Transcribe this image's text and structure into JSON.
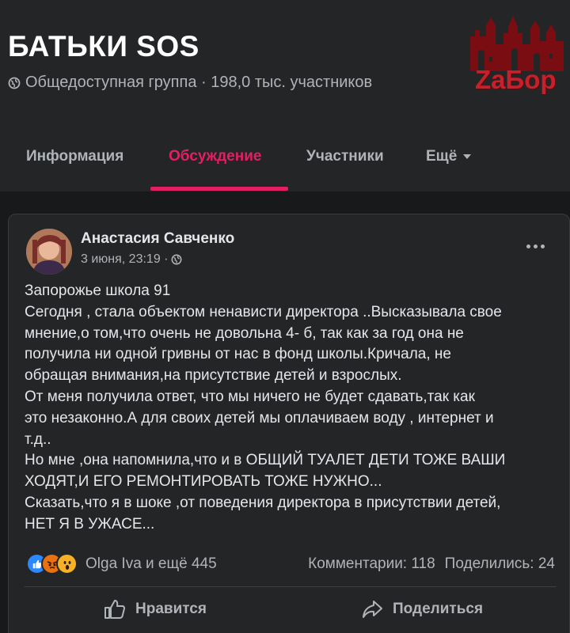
{
  "group": {
    "name": "БАТЬКИ SOS",
    "meta": "Общедоступная группа · 198,0 тыс. участников",
    "globe_icon": "globe-icon"
  },
  "logo": {
    "text": "ZaБор",
    "color": "#c6202a"
  },
  "tabs": [
    {
      "label": "Информация",
      "active": false
    },
    {
      "label": "Обсуждение",
      "active": true
    },
    {
      "label": "Участники",
      "active": false
    },
    {
      "label": "Ещё",
      "active": false
    }
  ],
  "post": {
    "author": "Анастасия Савченко",
    "time": "3 июня, 23:19 ·",
    "lines": [
      "Запорожье школа 91",
      "Сегодня , стала объектом ненависти директора ..Высказывала свое",
      "мнение,о том,что очень не довольна 4- б, так как за год она не",
      "получила ни одной гривны от нас в фонд школы.Кричала, не",
      "обращая внимания,на присутствие детей и взрослых.",
      "От меня получила ответ, что мы ничего не будет сдавать,так как",
      "это незаконно.А для своих детей мы оплачиваем воду , интернет и",
      "т.д..",
      "Но мне ,она напомнила,что и в ОБЩИЙ ТУАЛЕТ ДЕТИ ТОЖЕ ВАШИ",
      "ХОДЯТ,И ЕГО РЕМОНТИРОВАТЬ ТОЖЕ НУЖНО...",
      "Сказать,что я в шоке ,от поведения директора в присутствии детей,",
      "НЕТ Я В УЖАСЕ..."
    ],
    "reactions_text": "Olga Iva и ещё 445",
    "comments": "Комментарии: 118",
    "shares": "Поделились: 24",
    "like_label": "Нравится",
    "share_label": "Поделиться"
  },
  "colors": {
    "accent": "#e41e63",
    "background": "#18191a",
    "card": "#242526",
    "muted": "#b0b3b8"
  }
}
